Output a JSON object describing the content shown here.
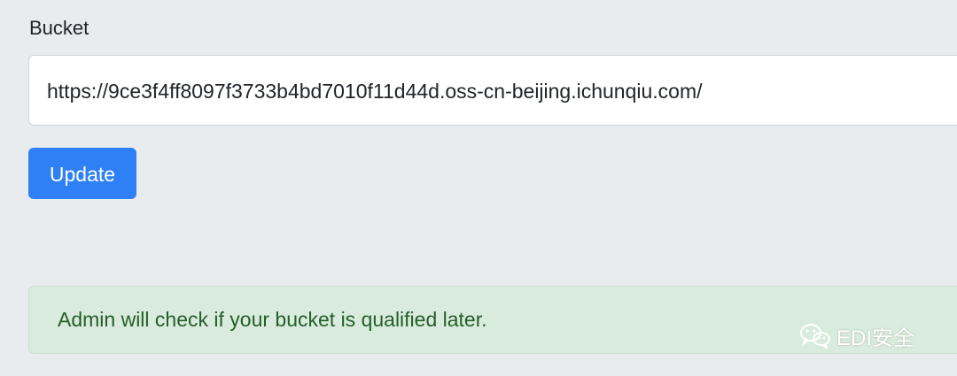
{
  "form": {
    "bucket_label": "Bucket",
    "bucket_value": "https://9ce3f4ff8097f3733b4bd7010f11d44d.oss-cn-beijing.ichunqiu.com/",
    "update_label": "Update"
  },
  "alert": {
    "message": "Admin will check if your bucket is qualified later."
  },
  "watermark": {
    "icon": "wechat-icon",
    "text": "EDI安全"
  },
  "colors": {
    "background": "#e9ecef",
    "primary": "#2f80f5",
    "success_bg": "#d9ebdc",
    "success_text": "#255e2b"
  }
}
